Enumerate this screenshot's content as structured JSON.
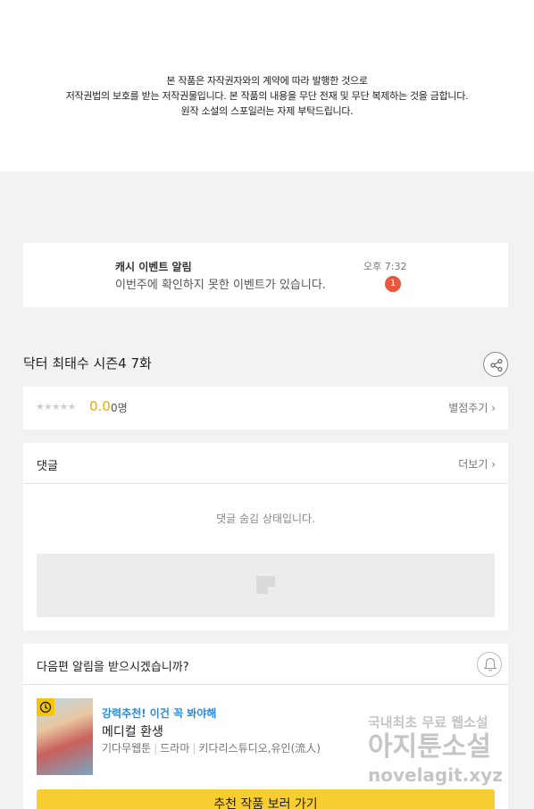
{
  "notice": {
    "line1": "본 작품은 자작권자와의 계약에 따라 발행한 것으로",
    "line2": "저작권법의 보호를 받는 저작권물입니다. 본 작품의 내용을 무단 전재 및 무단 복제하는 것을 금합니다.",
    "line3": "원작 소설의 스포일러는 자제 부탁드립니다."
  },
  "alarm": {
    "title": "캐시 이벤트 알림",
    "description": "이번주에 확인하지 못한 이벤트가 있습니다.",
    "time": "오후 7:32",
    "badge_count": "1"
  },
  "episode": {
    "title": "닥터 최태수 시즌4 7화"
  },
  "rating": {
    "stars": "★★★★★",
    "score": "0.0",
    "votes": "0명",
    "rate_link": "별점주기 ›"
  },
  "comments": {
    "title": "댓글",
    "more_link": "더보기 ›",
    "hidden_message": "댓글 숨김 상태입니다."
  },
  "next_episode": {
    "question": "다음편 알림을 받으시겠습니까?"
  },
  "recommendation": {
    "tag": "강력추천! 이건 꼭 봐야해",
    "title": "메디컬 환생",
    "genre1": "기다무웹툰",
    "genre2": "드라마",
    "author": "키다리스튜디오,유인(流人)",
    "cta_label": "추천 작품 보러 가기"
  },
  "watermark": {
    "line1": "국내최초 무료 웹소설",
    "line2": "아지툰소설",
    "line3": "novelagit.xyz"
  },
  "colors": {
    "accent_yellow": "#f8cd2f",
    "badge_red": "#e8573e",
    "score_orange": "#f0a800",
    "tag_blue": "#2a8ae0"
  },
  "icons": [
    "share-icon",
    "bell-icon",
    "clock-icon",
    "image-placeholder-icon",
    "star-icon"
  ]
}
